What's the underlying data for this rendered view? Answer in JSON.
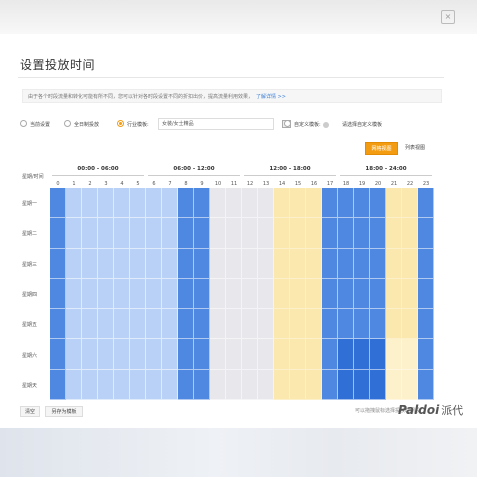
{
  "header": {
    "title": "设置投放时间"
  },
  "notice": {
    "text": "由于各个时段流量和转化可能有所不同，您可以针对各时段设置不同的折扣出价，提高流量利用效果，",
    "link": "了解详情 >>"
  },
  "options": [
    {
      "label": "当前设置",
      "selected": false
    },
    {
      "label": "全日制投放",
      "selected": false
    },
    {
      "label": "行业模板:",
      "selected": true
    },
    {
      "label": "自定义模板:",
      "selected": false
    }
  ],
  "template_select": {
    "value": "女装/女士精品"
  },
  "custom_template_placeholder": "请选择自定义模板",
  "view_buttons": {
    "active": "网格视图",
    "other": "列表视图"
  },
  "corner_label": "星期/时间",
  "time_groups": [
    "00:00 - 06:00",
    "06:00 - 12:00",
    "12:00 - 18:00",
    "18:00 - 24:00"
  ],
  "hours": [
    "0",
    "1",
    "2",
    "3",
    "4",
    "5",
    "6",
    "7",
    "8",
    "9",
    "10",
    "11",
    "12",
    "13",
    "14",
    "15",
    "16",
    "17",
    "18",
    "19",
    "20",
    "21",
    "22",
    "23"
  ],
  "days": [
    "星期一",
    "星期二",
    "星期三",
    "星期四",
    "星期五",
    "星期六",
    "星期天"
  ],
  "cell_levels_by_hour": [
    "dark",
    "light",
    "light",
    "light",
    "light",
    "light",
    "light",
    "light",
    "dark",
    "dark",
    "gray",
    "gray",
    "gray",
    "gray",
    "yellow",
    "yellow",
    "yellow",
    "dark",
    "dark",
    "dark",
    "dark",
    "yellow",
    "yellow",
    "dark"
  ],
  "weekend_cell_levels_by_hour": [
    "dark",
    "light",
    "light",
    "light",
    "light",
    "light",
    "light",
    "light",
    "dark",
    "dark",
    "gray",
    "gray",
    "gray",
    "gray",
    "yellow",
    "yellow",
    "yellow",
    "dark",
    "deep",
    "deep",
    "deep",
    "paleyellow",
    "paleyellow",
    "dark"
  ],
  "colors": {
    "dark": "#4f88e0",
    "deep": "#2f6fd6",
    "light": "#b9d1f6",
    "gray": "#e8e8ec",
    "yellow": "#fbe8ae",
    "paleyellow": "#fdf1cc",
    "accent": "#f39c12",
    "link": "#3d7fd6"
  },
  "bottom": {
    "clear_label": "清空",
    "save_template_label": "另存为模板",
    "hint": "可以拖拽鼠标选择投放时间段"
  },
  "watermark": {
    "latin": "Paldoi",
    "cn": "派代"
  }
}
